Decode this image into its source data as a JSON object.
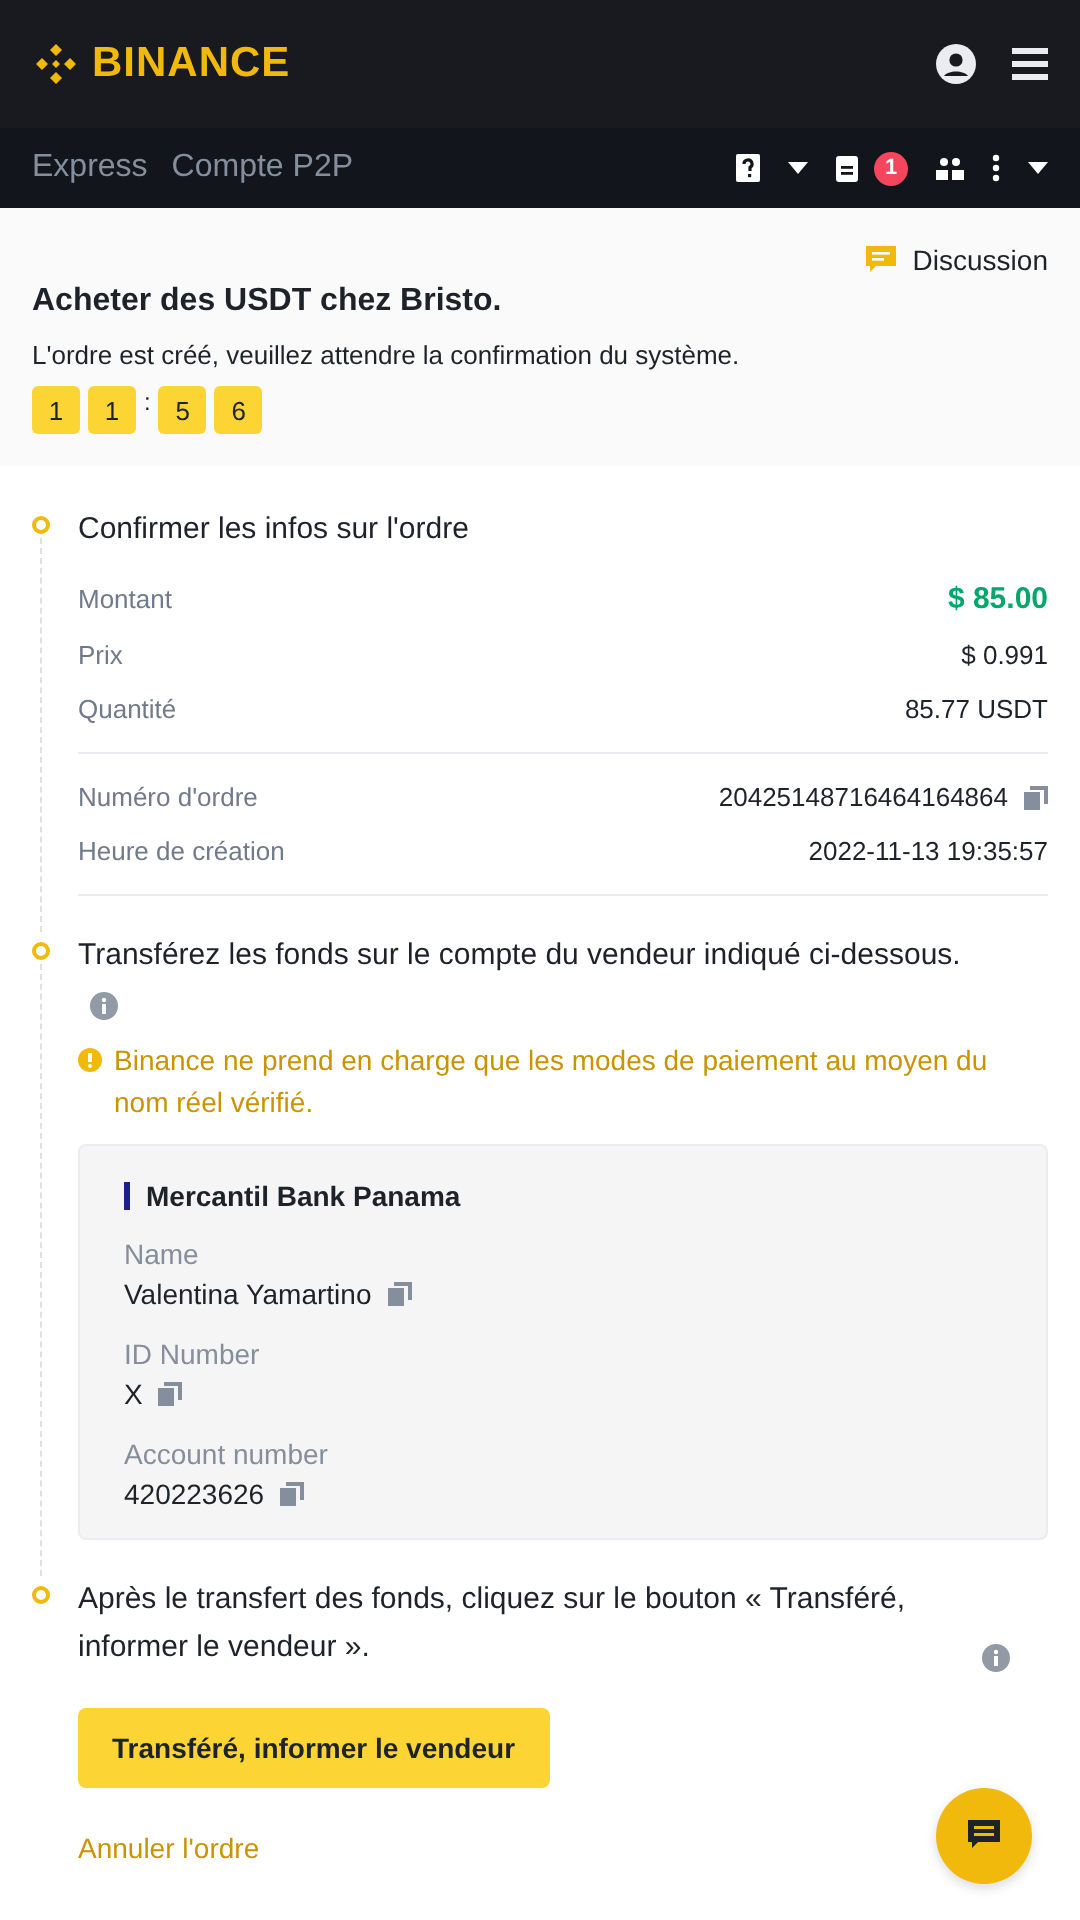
{
  "header": {
    "logo": "BINANCE"
  },
  "nav": {
    "tabs": [
      "Express",
      "Compte P2P"
    ],
    "badge": "1"
  },
  "order": {
    "chat_link": "Discussion",
    "title": "Acheter des USDT chez Bristo.",
    "status": "L'ordre est créé, veuillez attendre la confirmation du système.",
    "timer": [
      "1",
      "1",
      "5",
      "6"
    ],
    "separator": ":"
  },
  "steps": [
    {
      "kind": "details",
      "title": "Confirmer les infos sur l'ordre",
      "groups": [
        [
          {
            "label": "Montant",
            "value": "$ 85.00",
            "emphasis": true,
            "copyable": false
          },
          {
            "label": "Prix",
            "value": "$ 0.991",
            "emphasis": false,
            "copyable": false
          },
          {
            "label": "Quantité",
            "value": "85.77 USDT",
            "emphasis": false,
            "copyable": false
          }
        ],
        [
          {
            "label": "Numéro d'ordre",
            "value": "20425148716464164864",
            "emphasis": false,
            "copyable": true
          },
          {
            "label": "Heure de création",
            "value": "2022-11-13 19:35:57",
            "emphasis": false,
            "copyable": false
          }
        ]
      ]
    },
    {
      "kind": "payment",
      "title": "Transférez les fonds sur le compte du vendeur indiqué ci-dessous.",
      "warning": "Binance ne prend en charge que les modes de paiement au moyen du nom réel vérifié.",
      "bank": "Mercantil Bank Panama",
      "fields": [
        {
          "label": "Name",
          "value": "Valentina Yamartino"
        },
        {
          "label": "ID Number",
          "value": "X"
        },
        {
          "label": "Account number",
          "value": "420223626"
        }
      ]
    },
    {
      "kind": "action",
      "title": "Après le transfert des fonds, cliquez sur le bouton « Transféré, informer le vendeur ».",
      "button": "Transféré, informer le vendeur",
      "cancel": "Annuler l'ordre"
    }
  ]
}
